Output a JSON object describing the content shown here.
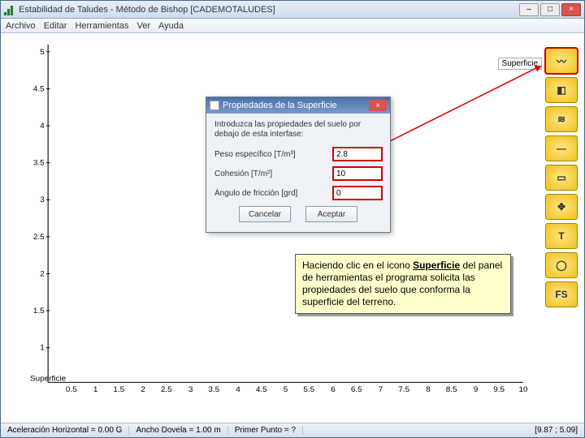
{
  "window": {
    "title": "Estabilidad de Taludes - Método de Bishop  [CADEMOTALUDES]"
  },
  "menu": [
    "Archivo",
    "Editar",
    "Herramientas",
    "Ver",
    "Ayuda"
  ],
  "toolpanel": {
    "tooltip": "Superficie",
    "buttons": [
      {
        "name": "surface",
        "glyph": "〰",
        "selected": true
      },
      {
        "name": "halfspace",
        "glyph": "◧"
      },
      {
        "name": "water",
        "glyph": "≋"
      },
      {
        "name": "line",
        "glyph": "—"
      },
      {
        "name": "grid",
        "glyph": "▭"
      },
      {
        "name": "center",
        "glyph": "✥"
      },
      {
        "name": "text",
        "glyph": "T"
      },
      {
        "name": "circle",
        "glyph": "◯"
      },
      {
        "name": "fs",
        "glyph": "FS"
      }
    ]
  },
  "chart_data": {
    "type": "line",
    "title": "",
    "xlabel": "",
    "ylabel": "",
    "xlim": [
      0,
      10
    ],
    "ylim": [
      0,
      5
    ],
    "xticks": [
      0.5,
      1,
      1.5,
      2,
      2.5,
      3,
      3.5,
      4,
      4.5,
      5,
      5.5,
      6,
      6.5,
      7,
      7.5,
      8,
      8.5,
      9,
      9.5,
      10
    ],
    "yticks": [
      1,
      1.5,
      2,
      2.5,
      3,
      3.5,
      4,
      4.5,
      5
    ],
    "series": [],
    "annotations": [
      {
        "text": "Superficie",
        "x": 0.2,
        "y": 0.1
      }
    ]
  },
  "dialog": {
    "title": "Propiedades de la Superficie",
    "instruction": "Introduzca las propiedades del suelo por debajo de esta interfase:",
    "fields": [
      {
        "label": "Peso específico [T/m³]",
        "value": "2.8"
      },
      {
        "label": "Cohesión          [T/m²]",
        "value": "10"
      },
      {
        "label": "Ángulo de fricción [grd]",
        "value": "0"
      }
    ],
    "btn_cancel": "Cancelar",
    "btn_ok": "Aceptar"
  },
  "callout": {
    "pre": "Haciendo clic en el icono ",
    "bold": "Superficie",
    "post": " del panel de herramientas el programa solicita las propiedades del suelo que conforma la superficie del terreno."
  },
  "status": {
    "accel": "Aceleración Horizontal = 0.00 G",
    "dovela": "Ancho Dovela = 1.00 m",
    "prompt": "Primer Punto = ?",
    "coords": "[9.87 ; 5.09]"
  }
}
